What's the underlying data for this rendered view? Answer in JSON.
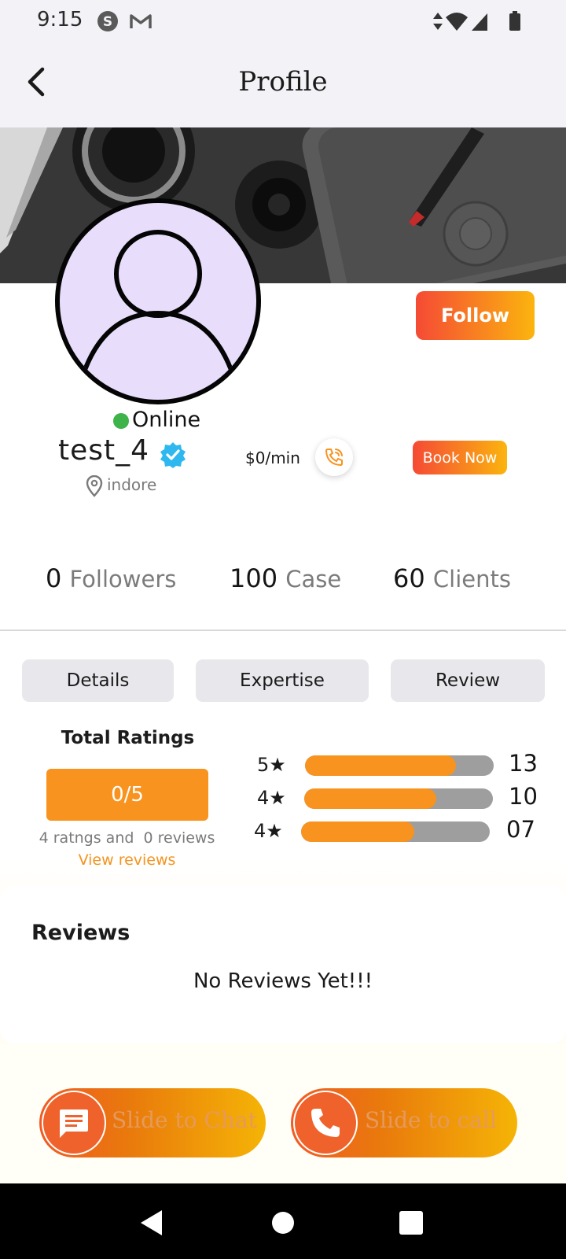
{
  "status_bar": {
    "time": "9:15",
    "icons": [
      "skype-icon",
      "gmail-icon",
      "data-arrows-icon",
      "wifi-icon",
      "signal-icon",
      "battery-icon"
    ]
  },
  "header": {
    "title": "Profile",
    "back_icon": "back-arrow-icon"
  },
  "profile": {
    "status": "Online",
    "username": "test_4",
    "location": "indore",
    "rate": "$0/min",
    "follow_label": "Follow",
    "book_label": "Book Now"
  },
  "stats": [
    {
      "value": "0",
      "label": "Followers"
    },
    {
      "value": "100",
      "label": "Case"
    },
    {
      "value": "60",
      "label": "Clients"
    }
  ],
  "tabs": [
    "Details",
    "Expertise",
    "Review"
  ],
  "ratings": {
    "title": "Total Ratings",
    "score": "0/5",
    "summary": "4 ratngs and  0 reviews",
    "view_reviews": "View reviews",
    "bars": [
      {
        "label": "5★",
        "fraction": 0.8,
        "count": "13"
      },
      {
        "label": "4★",
        "fraction": 0.7,
        "count": "10"
      },
      {
        "label": "4★",
        "fraction": 0.6,
        "count": "07"
      }
    ]
  },
  "reviews": {
    "title": "Reviews",
    "empty": "No Reviews Yet!!!"
  },
  "actions": {
    "chat": "Slide to Chat",
    "call": "Slide to call"
  },
  "colors": {
    "accent": "#f7931e",
    "gradient_start": "#f54a35",
    "gradient_end": "#fbb40e",
    "online": "#3db34a",
    "verified": "#2fb8f0"
  }
}
